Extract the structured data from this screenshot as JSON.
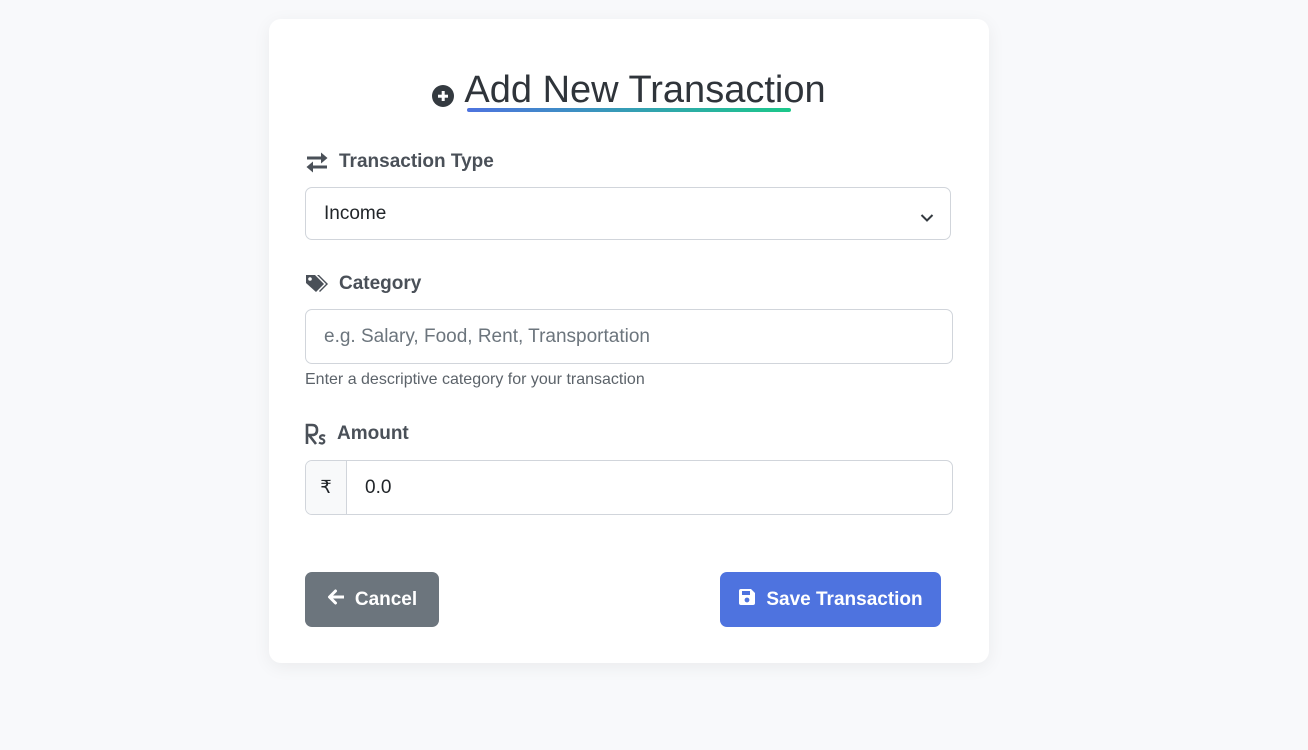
{
  "header": {
    "title": "Add New Transaction",
    "icon": "plus-circle-icon"
  },
  "colors": {
    "primary": "#4e73df",
    "secondary": "#6c757d",
    "accent_end": "#1cc88a"
  },
  "form": {
    "type": {
      "label": "Transaction Type",
      "icon": "exchange-arrows-icon",
      "value": "Income"
    },
    "category": {
      "label": "Category",
      "icon": "tags-icon",
      "value": "",
      "placeholder": "e.g. Salary, Food, Rent, Transportation",
      "help": "Enter a descriptive category for your transaction"
    },
    "amount": {
      "label": "Amount",
      "icon": "rupee-sign-icon",
      "prefix": "₹",
      "value": "0.0"
    }
  },
  "actions": {
    "cancel_label": "Cancel",
    "cancel_icon": "arrow-left-icon",
    "save_label": "Save Transaction",
    "save_icon": "floppy-disk-icon"
  }
}
